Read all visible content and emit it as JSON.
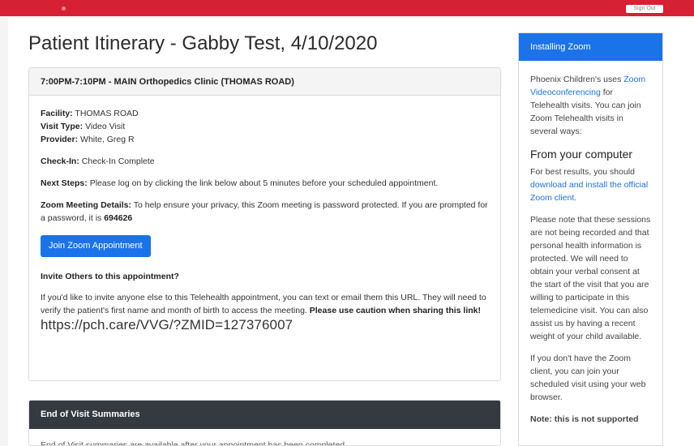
{
  "topbar": {
    "button_label": "Sign Out"
  },
  "page": {
    "title": "Patient Itinerary - Gabby Test, 4/10/2020"
  },
  "appointment": {
    "header": "7:00PM-7:10PM - MAIN Orthopedics Clinic (THOMAS ROAD)",
    "facility_label": "Facility:",
    "facility_value": "THOMAS ROAD",
    "visit_type_label": "Visit Type:",
    "visit_type_value": "Video Visit",
    "provider_label": "Provider:",
    "provider_value": "White, Greg R",
    "checkin_label": "Check-In:",
    "checkin_value": "Check-In Complete",
    "next_steps_label": "Next Steps:",
    "next_steps_value": "Please log on by clicking the link below about 5 minutes before your scheduled appointment.",
    "zoom_label": "Zoom Meeting Details:",
    "zoom_text": "To help ensure your privacy, this Zoom meeting is password protected. If you are prompted for a password, it is",
    "zoom_password": "694626",
    "join_button": "Join Zoom Appointment",
    "invite_heading": "Invite Others to this appointment?",
    "invite_text": "If you'd like to invite anyone else to this Telehealth appointment, you can text or email them this URL. They will need to verify the patient's first name and month of birth to access the meeting.",
    "invite_caution": "Please use caution when sharing this link!",
    "url": "https://pch.care/VVG/?ZMID=127376007"
  },
  "summaries": {
    "header": "End of Visit Summaries",
    "text": "End of Visit summaries are available after your appointment has been completed."
  },
  "sidebar": {
    "header": "Installing Zoom",
    "intro_before": "Phoenix Children's uses",
    "intro_link": "Zoom Videoconferencing",
    "intro_after": "for Telehealth visits. You can join Zoom Telehealth visits in several ways:",
    "computer_heading": "From your computer",
    "computer_before": "For best results, you should",
    "computer_link": "download and install the official Zoom client",
    "computer_after": ".",
    "note": "Please note that these sessions are not being recorded and that personal health information is protected. We will need to obtain your verbal consent at the start of the visit that you are willing to participate in this telemedicine visit. You can also assist us by having a recent weight of your child available.",
    "browser": "If you don't have the Zoom client, you can join your scheduled visit using your web browser.",
    "browser_note": "Note: this is not supported"
  }
}
